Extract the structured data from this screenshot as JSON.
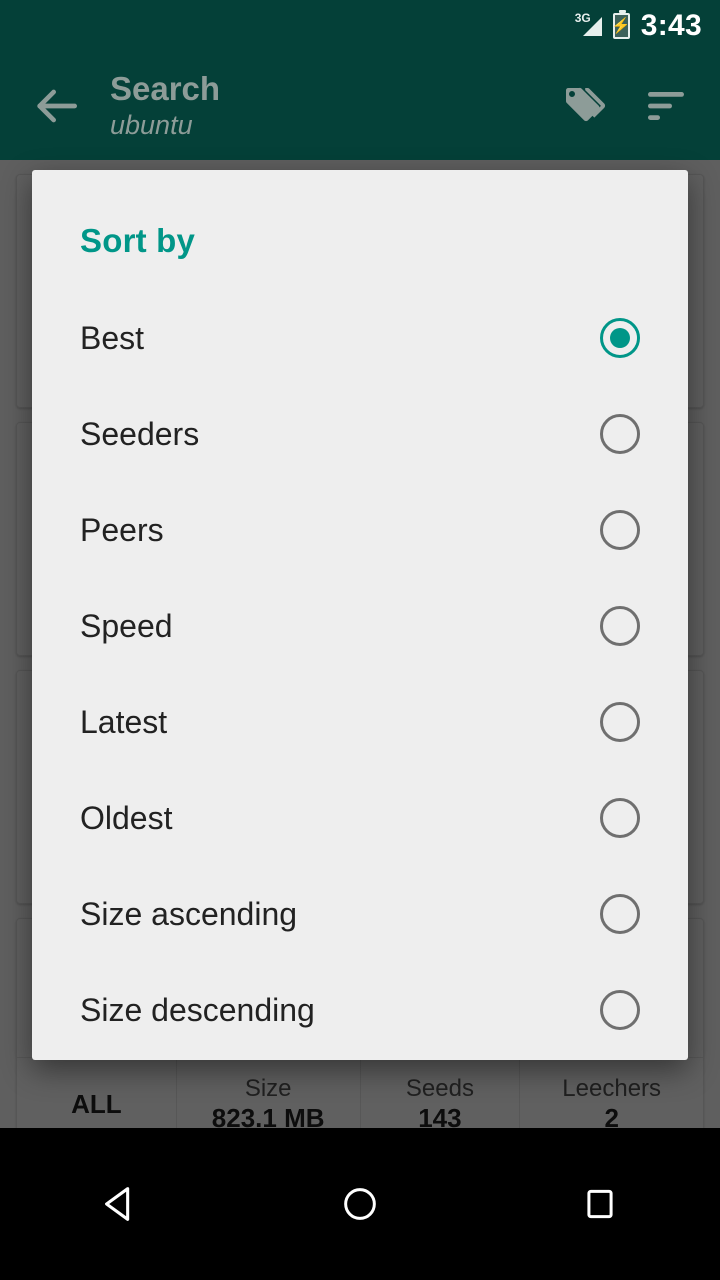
{
  "status_bar": {
    "network_label": "3G",
    "time": "3:43",
    "signal_icon": "signal-3g-icon",
    "battery_icon": "battery-charging-icon"
  },
  "toolbar": {
    "back_icon": "arrow-back-icon",
    "title": "Search",
    "subtitle": "ubuntu",
    "tags_icon": "tags-icon",
    "sort_icon": "sort-icon"
  },
  "dialog": {
    "title": "Sort by",
    "accent_color": "#009688",
    "background_color": "#eeeeee",
    "selected_index": 0,
    "options": [
      {
        "label": "Best",
        "selected": true
      },
      {
        "label": "Seeders",
        "selected": false
      },
      {
        "label": "Peers",
        "selected": false
      },
      {
        "label": "Speed",
        "selected": false
      },
      {
        "label": "Latest",
        "selected": false
      },
      {
        "label": "Oldest",
        "selected": false
      },
      {
        "label": "Size ascending",
        "selected": false
      },
      {
        "label": "Size descending",
        "selected": false
      }
    ]
  },
  "background_results": {
    "visible_card": {
      "all_label": "ALL",
      "columns": [
        {
          "label": "Size",
          "value": "823.1 MB"
        },
        {
          "label": "Seeds",
          "value": "143"
        },
        {
          "label": "Leechers",
          "value": "2"
        }
      ]
    }
  },
  "nav_bar": {
    "back_icon": "nav-back-triangle-icon",
    "home_icon": "nav-home-circle-icon",
    "recents_icon": "nav-recents-square-icon"
  },
  "theme": {
    "toolbar_color": "#044038",
    "accent": "#009688",
    "nav_bar_color": "#000000"
  }
}
